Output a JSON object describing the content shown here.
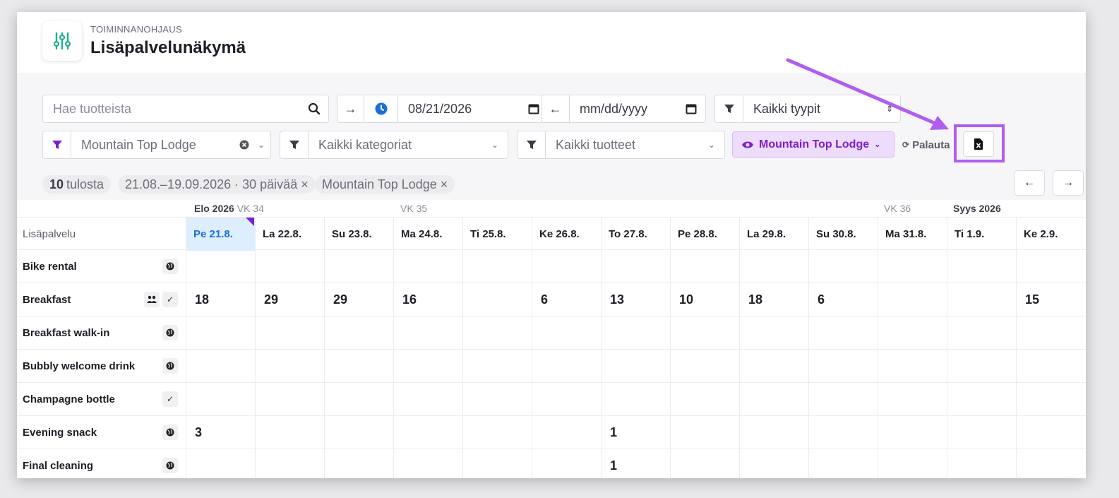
{
  "header": {
    "eyebrow": "TOIMINNANOHJAUS",
    "title": "Lisäpalvelunäkymä"
  },
  "filters": {
    "search_placeholder": "Hae tuotteista",
    "start_date": "08/21/2026",
    "end_date_placeholder": "mm/dd/yyyy",
    "type_filter": "Kaikki tyypit",
    "property_filter": "Mountain Top Lodge",
    "category_filter": "Kaikki kategoriat",
    "product_filter": "Kaikki tuotteet",
    "view_pill": "Mountain Top Lodge",
    "reset_label": "Palauta"
  },
  "summary": {
    "count": "10",
    "count_label": "tulosta",
    "range_chip": "21.08.–19.09.2026 · 30 päivää ×",
    "property_chip": "Mountain Top Lodge ×"
  },
  "weeks": {
    "w34_month": "Elo 2026",
    "w34": "VK 34",
    "w35": "VK 35",
    "w36": "VK 36",
    "w36_month": "Syys 2026"
  },
  "table": {
    "header_label": "Lisäpalvelu",
    "days": [
      "Pe 21.8.",
      "La 22.8.",
      "Su 23.8.",
      "Ma 24.8.",
      "Ti 25.8.",
      "Ke 26.8.",
      "To 27.8.",
      "Pe 28.8.",
      "La 29.8.",
      "Su 30.8.",
      "Ma 31.8.",
      "Ti 1.9.",
      "Ke 2.9."
    ],
    "rows": [
      {
        "name": "Bike rental",
        "values": [
          "",
          "",
          "",
          "",
          "",
          "",
          "",
          "",
          "",
          "",
          "",
          "",
          ""
        ]
      },
      {
        "name": "Breakfast",
        "values": [
          "18",
          "29",
          "29",
          "16",
          "",
          "6",
          "13",
          "10",
          "18",
          "6",
          "",
          "",
          "15"
        ]
      },
      {
        "name": "Breakfast walk-in",
        "values": [
          "",
          "",
          "",
          "",
          "",
          "",
          "",
          "",
          "",
          "",
          "",
          "",
          ""
        ]
      },
      {
        "name": "Bubbly welcome drink",
        "values": [
          "",
          "",
          "",
          "",
          "",
          "",
          "",
          "",
          "",
          "",
          "",
          "",
          ""
        ]
      },
      {
        "name": "Champagne bottle",
        "values": [
          "",
          "",
          "",
          "",
          "",
          "",
          "",
          "",
          "",
          "",
          "",
          "",
          ""
        ]
      },
      {
        "name": "Evening snack",
        "values": [
          "3",
          "",
          "",
          "",
          "",
          "",
          "1",
          "",
          "",
          "",
          "",
          "",
          ""
        ]
      },
      {
        "name": "Final cleaning",
        "values": [
          "",
          "",
          "",
          "",
          "",
          "",
          "1",
          "",
          "",
          "",
          "",
          "",
          ""
        ]
      }
    ]
  }
}
